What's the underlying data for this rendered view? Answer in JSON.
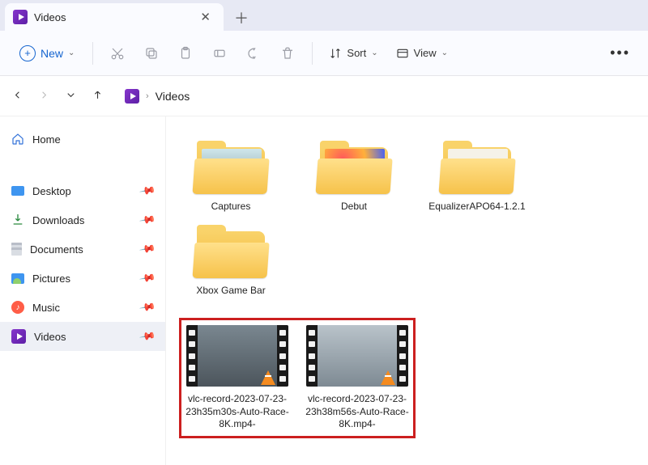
{
  "tab": {
    "title": "Videos"
  },
  "toolbar": {
    "new_label": "New",
    "sort_label": "Sort",
    "view_label": "View"
  },
  "breadcrumb": {
    "current": "Videos"
  },
  "sidebar": {
    "home": "Home",
    "items": [
      {
        "label": "Desktop"
      },
      {
        "label": "Downloads"
      },
      {
        "label": "Documents"
      },
      {
        "label": "Pictures"
      },
      {
        "label": "Music"
      },
      {
        "label": "Videos"
      }
    ]
  },
  "folders": [
    {
      "name": "Captures"
    },
    {
      "name": "Debut"
    },
    {
      "name": "EqualizerAPO64-1.2.1"
    },
    {
      "name": "Xbox Game Bar"
    }
  ],
  "videos": [
    {
      "name": "vlc-record-2023-07-23-23h35m30s-Auto-Race-8K.mp4-"
    },
    {
      "name": "vlc-record-2023-07-23-23h38m56s-Auto-Race-8K.mp4-"
    }
  ]
}
